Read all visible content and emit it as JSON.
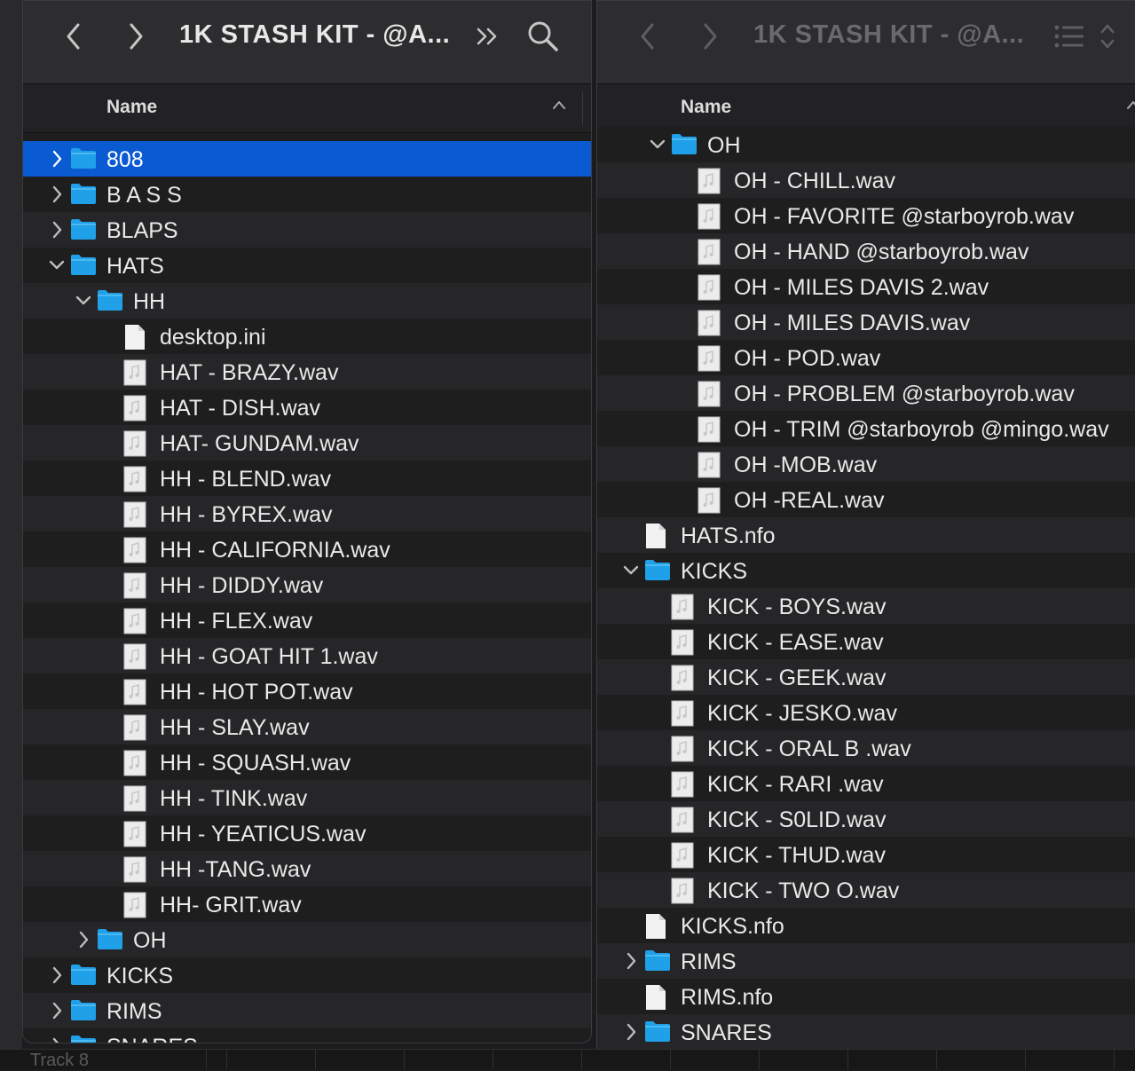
{
  "left_window": {
    "title": "1K STASH KIT - @A...",
    "column_header": "Name",
    "rows": [
      {
        "label": "808",
        "type": "folder",
        "depth": 0,
        "expanded": false,
        "selected": true
      },
      {
        "label": "B A S S",
        "type": "folder",
        "depth": 0,
        "expanded": false
      },
      {
        "label": "BLAPS",
        "type": "folder",
        "depth": 0,
        "expanded": false
      },
      {
        "label": "HATS",
        "type": "folder",
        "depth": 0,
        "expanded": true
      },
      {
        "label": "HH",
        "type": "folder",
        "depth": 1,
        "expanded": true
      },
      {
        "label": "desktop.ini",
        "type": "doc",
        "depth": 2
      },
      {
        "label": "HAT - BRAZY.wav",
        "type": "audio",
        "depth": 2
      },
      {
        "label": "HAT - DISH.wav",
        "type": "audio",
        "depth": 2
      },
      {
        "label": "HAT- GUNDAM.wav",
        "type": "audio",
        "depth": 2
      },
      {
        "label": "HH - BLEND.wav",
        "type": "audio",
        "depth": 2
      },
      {
        "label": "HH - BYREX.wav",
        "type": "audio",
        "depth": 2
      },
      {
        "label": "HH - CALIFORNIA.wav",
        "type": "audio",
        "depth": 2
      },
      {
        "label": "HH - DIDDY.wav",
        "type": "audio",
        "depth": 2
      },
      {
        "label": "HH - FLEX.wav",
        "type": "audio",
        "depth": 2
      },
      {
        "label": "HH - GOAT HIT 1.wav",
        "type": "audio",
        "depth": 2
      },
      {
        "label": "HH - HOT POT.wav",
        "type": "audio",
        "depth": 2
      },
      {
        "label": "HH - SLAY.wav",
        "type": "audio",
        "depth": 2
      },
      {
        "label": "HH - SQUASH.wav",
        "type": "audio",
        "depth": 2
      },
      {
        "label": "HH - TINK.wav",
        "type": "audio",
        "depth": 2
      },
      {
        "label": "HH - YEATICUS.wav",
        "type": "audio",
        "depth": 2
      },
      {
        "label": "HH -TANG.wav",
        "type": "audio",
        "depth": 2
      },
      {
        "label": "HH- GRIT.wav",
        "type": "audio",
        "depth": 2
      },
      {
        "label": "OH",
        "type": "folder",
        "depth": 1,
        "expanded": false
      },
      {
        "label": "KICKS",
        "type": "folder",
        "depth": 0,
        "expanded": false
      },
      {
        "label": "RIMS",
        "type": "folder",
        "depth": 0,
        "expanded": false
      },
      {
        "label": "SNARES",
        "type": "folder",
        "depth": 0,
        "expanded": false
      }
    ]
  },
  "right_window": {
    "title": "1K STASH KIT - @A...",
    "column_header": "Name",
    "rows": [
      {
        "label": "OH",
        "type": "folder",
        "depth": 1,
        "expanded": true
      },
      {
        "label": "OH - CHILL.wav",
        "type": "audio",
        "depth": 2
      },
      {
        "label": "OH - FAVORITE @starboyrob.wav",
        "type": "audio",
        "depth": 2
      },
      {
        "label": "OH - HAND @starboyrob.wav",
        "type": "audio",
        "depth": 2
      },
      {
        "label": "OH - MILES DAVIS 2.wav",
        "type": "audio",
        "depth": 2
      },
      {
        "label": "OH - MILES DAVIS.wav",
        "type": "audio",
        "depth": 2
      },
      {
        "label": "OH - POD.wav",
        "type": "audio",
        "depth": 2
      },
      {
        "label": "OH - PROBLEM @starboyrob.wav",
        "type": "audio",
        "depth": 2
      },
      {
        "label": "OH - TRIM @starboyrob @mingo.wav",
        "type": "audio",
        "depth": 2
      },
      {
        "label": "OH -MOB.wav",
        "type": "audio",
        "depth": 2
      },
      {
        "label": "OH -REAL.wav",
        "type": "audio",
        "depth": 2
      },
      {
        "label": "HATS.nfo",
        "type": "doc",
        "depth": 0
      },
      {
        "label": "KICKS",
        "type": "folder",
        "depth": 0,
        "expanded": true
      },
      {
        "label": "KICK - BOYS.wav",
        "type": "audio",
        "depth": 1
      },
      {
        "label": "KICK - EASE.wav",
        "type": "audio",
        "depth": 1
      },
      {
        "label": "KICK - GEEK.wav",
        "type": "audio",
        "depth": 1
      },
      {
        "label": "KICK - JESKO.wav",
        "type": "audio",
        "depth": 1
      },
      {
        "label": "KICK - ORAL B .wav",
        "type": "audio",
        "depth": 1
      },
      {
        "label": "KICK - RARI .wav",
        "type": "audio",
        "depth": 1
      },
      {
        "label": "KICK - S0LID.wav",
        "type": "audio",
        "depth": 1
      },
      {
        "label": "KICK - THUD.wav",
        "type": "audio",
        "depth": 1
      },
      {
        "label": "KICK - TWO O.wav",
        "type": "audio",
        "depth": 1
      },
      {
        "label": "KICKS.nfo",
        "type": "doc",
        "depth": 0
      },
      {
        "label": "RIMS",
        "type": "folder",
        "depth": 0,
        "expanded": false
      },
      {
        "label": "RIMS.nfo",
        "type": "doc",
        "depth": 0
      },
      {
        "label": "SNARES",
        "type": "folder",
        "depth": 0,
        "expanded": false
      }
    ]
  },
  "bottom_bar": {
    "track_label": "Track 8"
  },
  "icons": {
    "back": "chevron-left-icon",
    "forward": "chevron-right-icon",
    "overflow": "double-chevron-right-icon",
    "search": "search-icon",
    "view_options": "list-view-icon",
    "stepper": "up-down-chevron-icon"
  },
  "colors": {
    "selection": "#0a5ad2",
    "folder": "#1fa0e8",
    "row_alt": "#262628",
    "row_base": "#1e1e1e"
  }
}
